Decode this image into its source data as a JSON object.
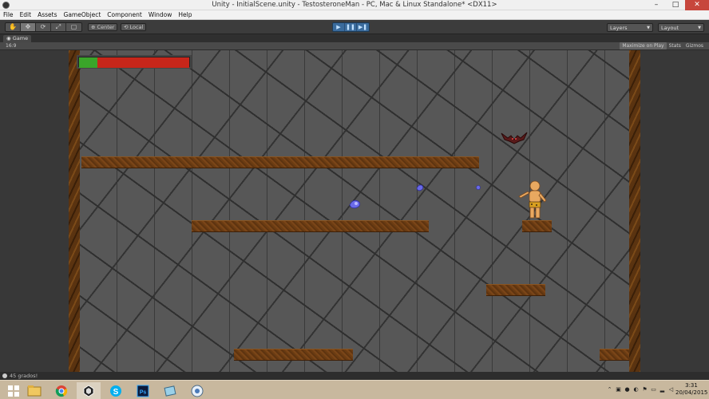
{
  "window": {
    "title": "Unity - InitialScene.unity - TestosteroneMan - PC, Mac & Linux Standalone* <DX11>",
    "controls": [
      "–",
      "□",
      "✕"
    ]
  },
  "menu": [
    "File",
    "Edit",
    "Assets",
    "GameObject",
    "Component",
    "Window",
    "Help"
  ],
  "toolbar": {
    "tools": [
      "hand-icon",
      "move-icon",
      "rotate-icon",
      "scale-icon",
      "rect-icon"
    ],
    "pivot": "Center",
    "space": "Local",
    "play_controls": [
      "play-icon",
      "pause-icon",
      "step-icon"
    ],
    "layers_label": "Layers",
    "layout_label": "Layout"
  },
  "game_panel": {
    "tab_label": "Game",
    "aspect": "16:9",
    "maximize_label": "Maximize on Play",
    "stats_label": "Stats",
    "gizmos_label": "Gizmos"
  },
  "hud": {
    "health_fraction": 0.17
  },
  "status": {
    "message": "45 grados!"
  },
  "taskbar": {
    "apps": [
      "windows-start-icon",
      "file-explorer-icon",
      "chrome-icon",
      "unity-icon",
      "skype-icon",
      "photoshop-icon",
      "app-icon",
      "remote-icon"
    ],
    "active_index": 3,
    "time": "3:31",
    "date": "20/04/2015"
  },
  "colors": {
    "health_green": "#3aa52a",
    "health_red": "#c7261a",
    "platform_brown": "#6b3c12",
    "play_blue": "#3a6b9c"
  }
}
